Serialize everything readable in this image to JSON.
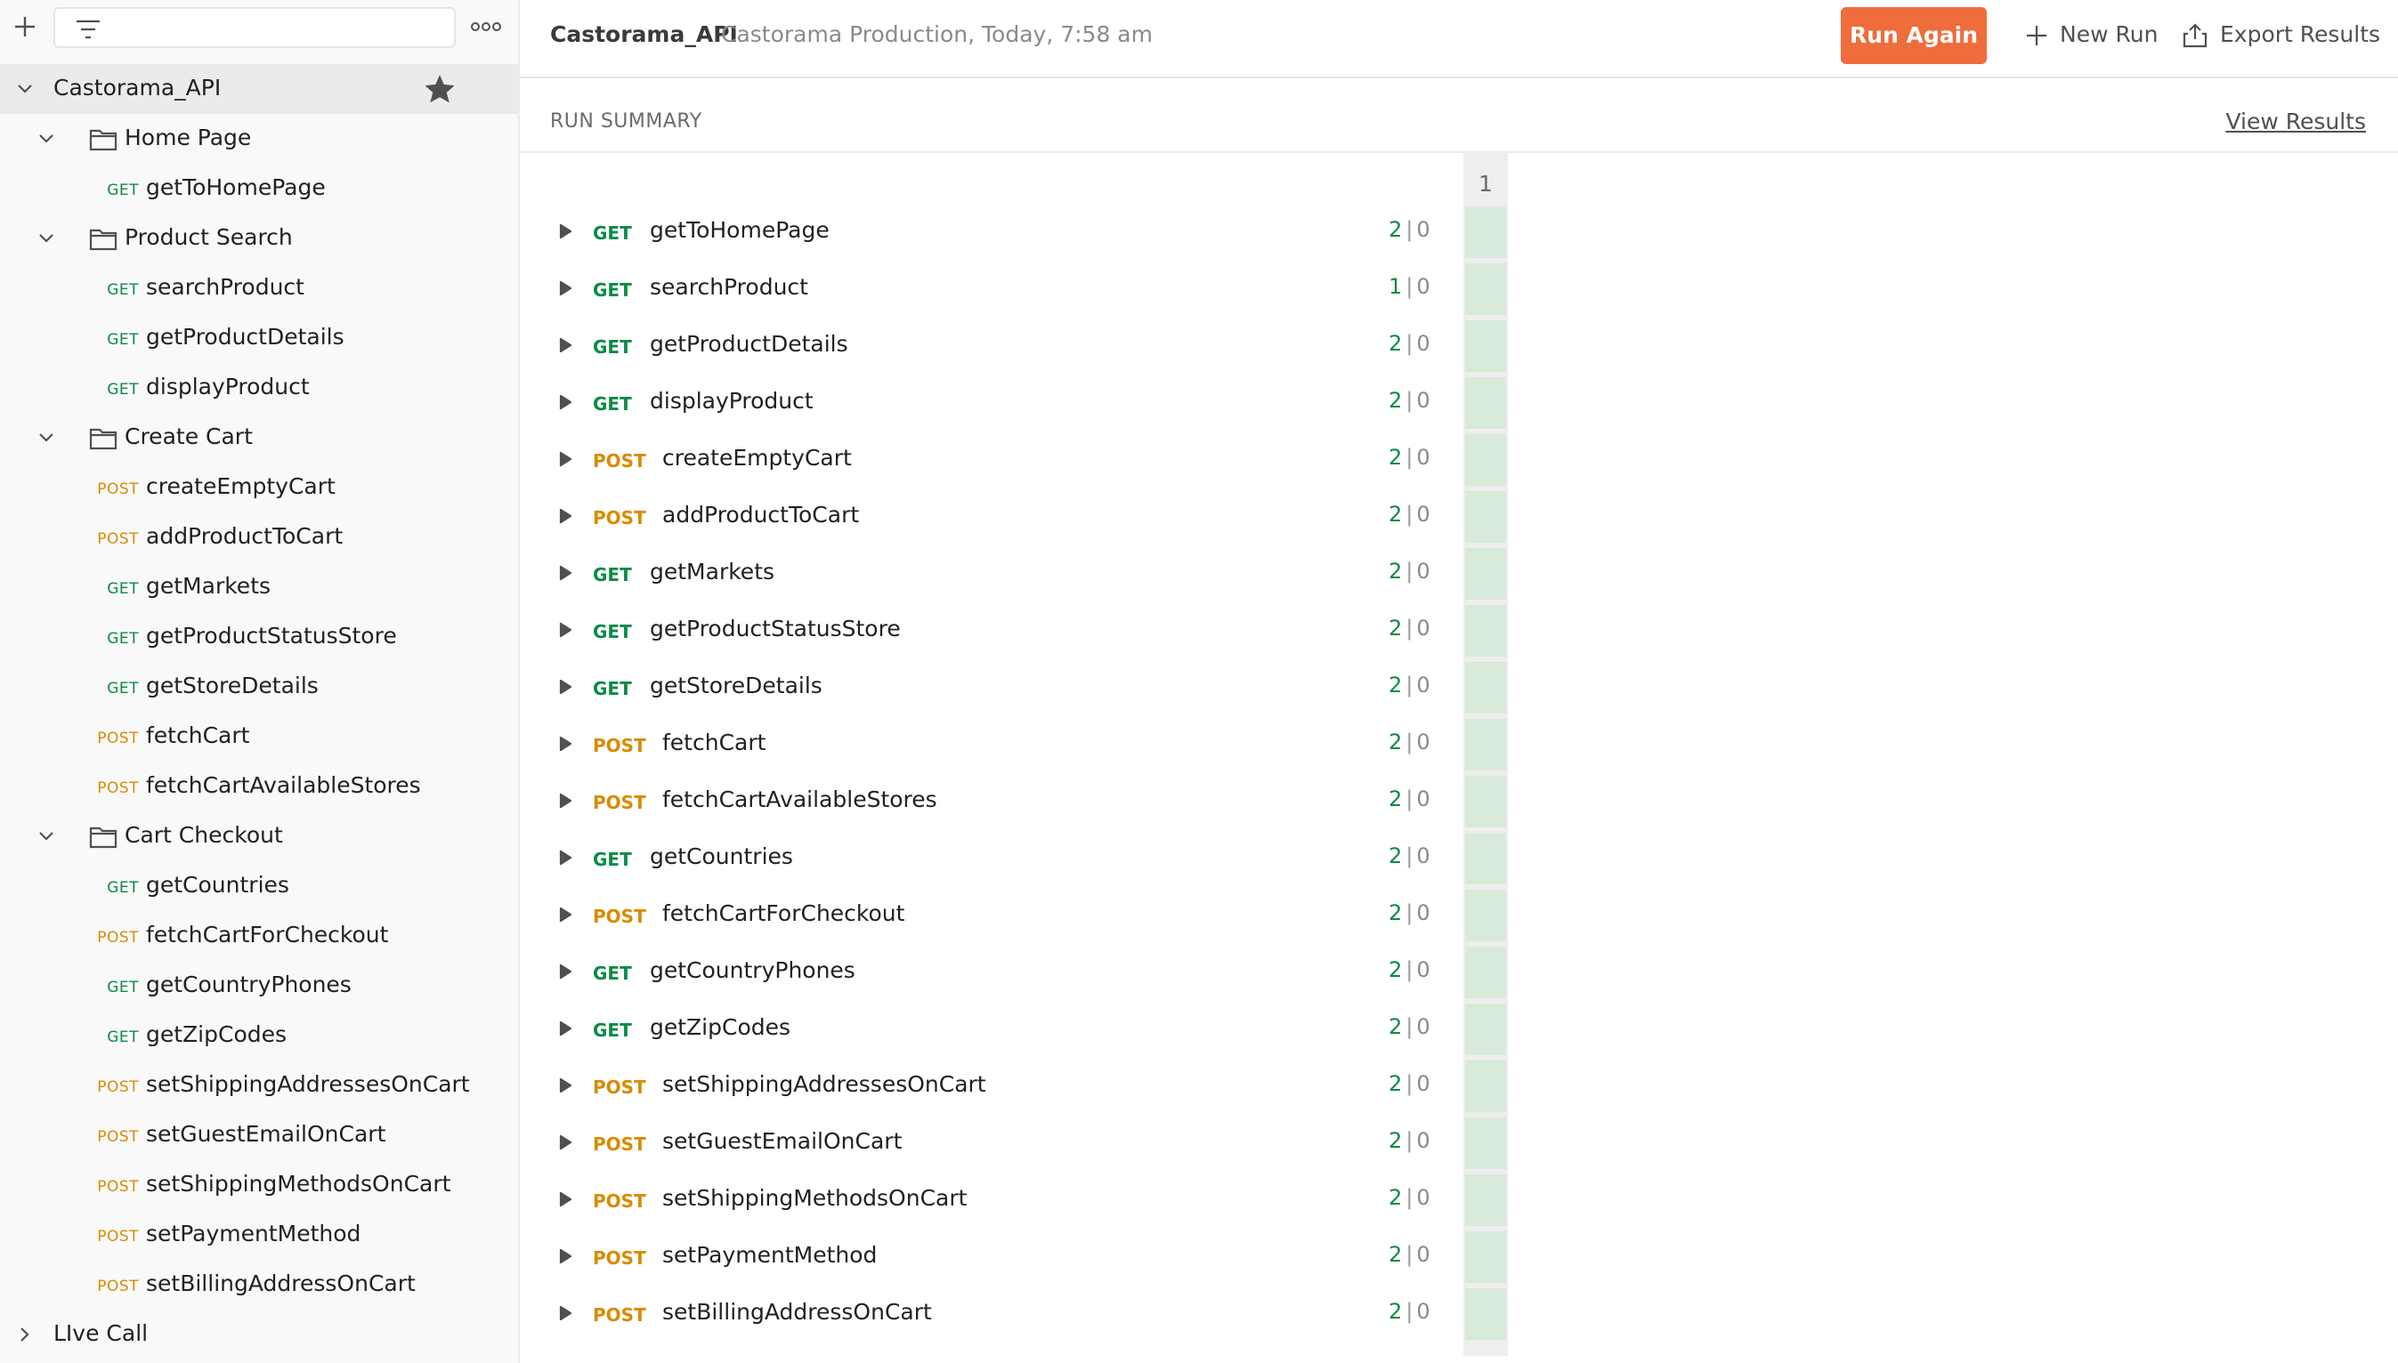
{
  "sidebar": {
    "search_value": "",
    "tree": [
      {
        "kind": "collection",
        "name": "Castorama_API",
        "level": 0,
        "expanded": true,
        "selected": true,
        "starred": true
      },
      {
        "kind": "folder",
        "name": "Home Page",
        "level": 1,
        "expanded": true
      },
      {
        "kind": "request",
        "method": "GET",
        "name": "getToHomePage",
        "level": 2
      },
      {
        "kind": "folder",
        "name": "Product Search",
        "level": 1,
        "expanded": true
      },
      {
        "kind": "request",
        "method": "GET",
        "name": "searchProduct",
        "level": 2
      },
      {
        "kind": "request",
        "method": "GET",
        "name": "getProductDetails",
        "level": 2
      },
      {
        "kind": "request",
        "method": "GET",
        "name": "displayProduct",
        "level": 2
      },
      {
        "kind": "folder",
        "name": "Create Cart",
        "level": 1,
        "expanded": true
      },
      {
        "kind": "request",
        "method": "POST",
        "name": "createEmptyCart",
        "level": 2
      },
      {
        "kind": "request",
        "method": "POST",
        "name": "addProductToCart",
        "level": 2
      },
      {
        "kind": "request",
        "method": "GET",
        "name": "getMarkets",
        "level": 2
      },
      {
        "kind": "request",
        "method": "GET",
        "name": "getProductStatusStore",
        "level": 2
      },
      {
        "kind": "request",
        "method": "GET",
        "name": "getStoreDetails",
        "level": 2
      },
      {
        "kind": "request",
        "method": "POST",
        "name": "fetchCart",
        "level": 2
      },
      {
        "kind": "request",
        "method": "POST",
        "name": "fetchCartAvailableStores",
        "level": 2
      },
      {
        "kind": "folder",
        "name": "Cart Checkout",
        "level": 1,
        "expanded": true
      },
      {
        "kind": "request",
        "method": "GET",
        "name": "getCountries",
        "level": 2
      },
      {
        "kind": "request",
        "method": "POST",
        "name": "fetchCartForCheckout",
        "level": 2
      },
      {
        "kind": "request",
        "method": "GET",
        "name": "getCountryPhones",
        "level": 2
      },
      {
        "kind": "request",
        "method": "GET",
        "name": "getZipCodes",
        "level": 2
      },
      {
        "kind": "request",
        "method": "POST",
        "name": "setShippingAddressesOnCart",
        "level": 2
      },
      {
        "kind": "request",
        "method": "POST",
        "name": "setGuestEmailOnCart",
        "level": 2
      },
      {
        "kind": "request",
        "method": "POST",
        "name": "setShippingMethodsOnCart",
        "level": 2
      },
      {
        "kind": "request",
        "method": "POST",
        "name": "setPaymentMethod",
        "level": 2
      },
      {
        "kind": "request",
        "method": "POST",
        "name": "setBillingAddressOnCart",
        "level": 2
      },
      {
        "kind": "collection",
        "name": "LIve Call",
        "level": 0,
        "expanded": false
      }
    ]
  },
  "header": {
    "title": "Castorama_API",
    "subtitle": "Castorama Production, Today, 7:58 am",
    "run_again_label": "Run Again",
    "new_run_label": "New Run",
    "export_label": "Export Results"
  },
  "summary": {
    "title": "RUN SUMMARY",
    "view_results_label": "View Results",
    "iteration_label": "1"
  },
  "results": [
    {
      "method": "GET",
      "name": "getToHomePage",
      "passed": "2",
      "failed": "0"
    },
    {
      "method": "GET",
      "name": "searchProduct",
      "passed": "1",
      "failed": "0"
    },
    {
      "method": "GET",
      "name": "getProductDetails",
      "passed": "2",
      "failed": "0"
    },
    {
      "method": "GET",
      "name": "displayProduct",
      "passed": "2",
      "failed": "0"
    },
    {
      "method": "POST",
      "name": "createEmptyCart",
      "passed": "2",
      "failed": "0"
    },
    {
      "method": "POST",
      "name": "addProductToCart",
      "passed": "2",
      "failed": "0"
    },
    {
      "method": "GET",
      "name": "getMarkets",
      "passed": "2",
      "failed": "0"
    },
    {
      "method": "GET",
      "name": "getProductStatusStore",
      "passed": "2",
      "failed": "0"
    },
    {
      "method": "GET",
      "name": "getStoreDetails",
      "passed": "2",
      "failed": "0"
    },
    {
      "method": "POST",
      "name": "fetchCart",
      "passed": "2",
      "failed": "0"
    },
    {
      "method": "POST",
      "name": "fetchCartAvailableStores",
      "passed": "2",
      "failed": "0"
    },
    {
      "method": "GET",
      "name": "getCountries",
      "passed": "2",
      "failed": "0"
    },
    {
      "method": "POST",
      "name": "fetchCartForCheckout",
      "passed": "2",
      "failed": "0"
    },
    {
      "method": "GET",
      "name": "getCountryPhones",
      "passed": "2",
      "failed": "0"
    },
    {
      "method": "GET",
      "name": "getZipCodes",
      "passed": "2",
      "failed": "0"
    },
    {
      "method": "POST",
      "name": "setShippingAddressesOnCart",
      "passed": "2",
      "failed": "0"
    },
    {
      "method": "POST",
      "name": "setGuestEmailOnCart",
      "passed": "2",
      "failed": "0"
    },
    {
      "method": "POST",
      "name": "setShippingMethodsOnCart",
      "passed": "2",
      "failed": "0"
    },
    {
      "method": "POST",
      "name": "setPaymentMethod",
      "passed": "2",
      "failed": "0"
    },
    {
      "method": "POST",
      "name": "setBillingAddressOnCart",
      "passed": "2",
      "failed": "0"
    }
  ],
  "colors": {
    "accent": "#ef6c3c",
    "get": "#0b8a47",
    "post": "#d98b00",
    "pass_cell": "#d8ead9"
  }
}
